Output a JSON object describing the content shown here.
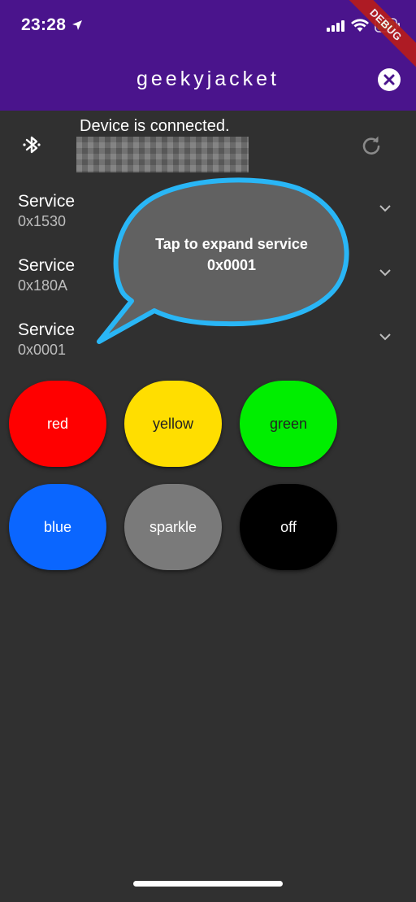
{
  "status_bar": {
    "time": "23:28"
  },
  "debug_banner": "DEBUG",
  "app_bar": {
    "title": "geekyjacket"
  },
  "device": {
    "status": "Device is connected.",
    "id_redacted": "redacted"
  },
  "services": [
    {
      "title": "Service",
      "uuid": "0x1530"
    },
    {
      "title": "Service",
      "uuid": "0x180A"
    },
    {
      "title": "Service",
      "uuid": "0x0001"
    }
  ],
  "callout": {
    "text": "Tap to expand service\n0x0001"
  },
  "color_buttons": [
    {
      "label": "red",
      "bg": "#ff0000",
      "fg": "#ffffff"
    },
    {
      "label": "yellow",
      "bg": "#ffde00",
      "fg": "#222222"
    },
    {
      "label": "green",
      "bg": "#00ee00",
      "fg": "#222222"
    },
    {
      "label": "blue",
      "bg": "#0a66ff",
      "fg": "#ffffff"
    },
    {
      "label": "sparkle",
      "bg": "#7a7a7a",
      "fg": "#ffffff"
    },
    {
      "label": "off",
      "bg": "#000000",
      "fg": "#ffffff"
    }
  ],
  "colors": {
    "app_bar": "#4a148c",
    "background": "#303030",
    "callout_fill": "#616161",
    "callout_border": "#29b6f6"
  }
}
